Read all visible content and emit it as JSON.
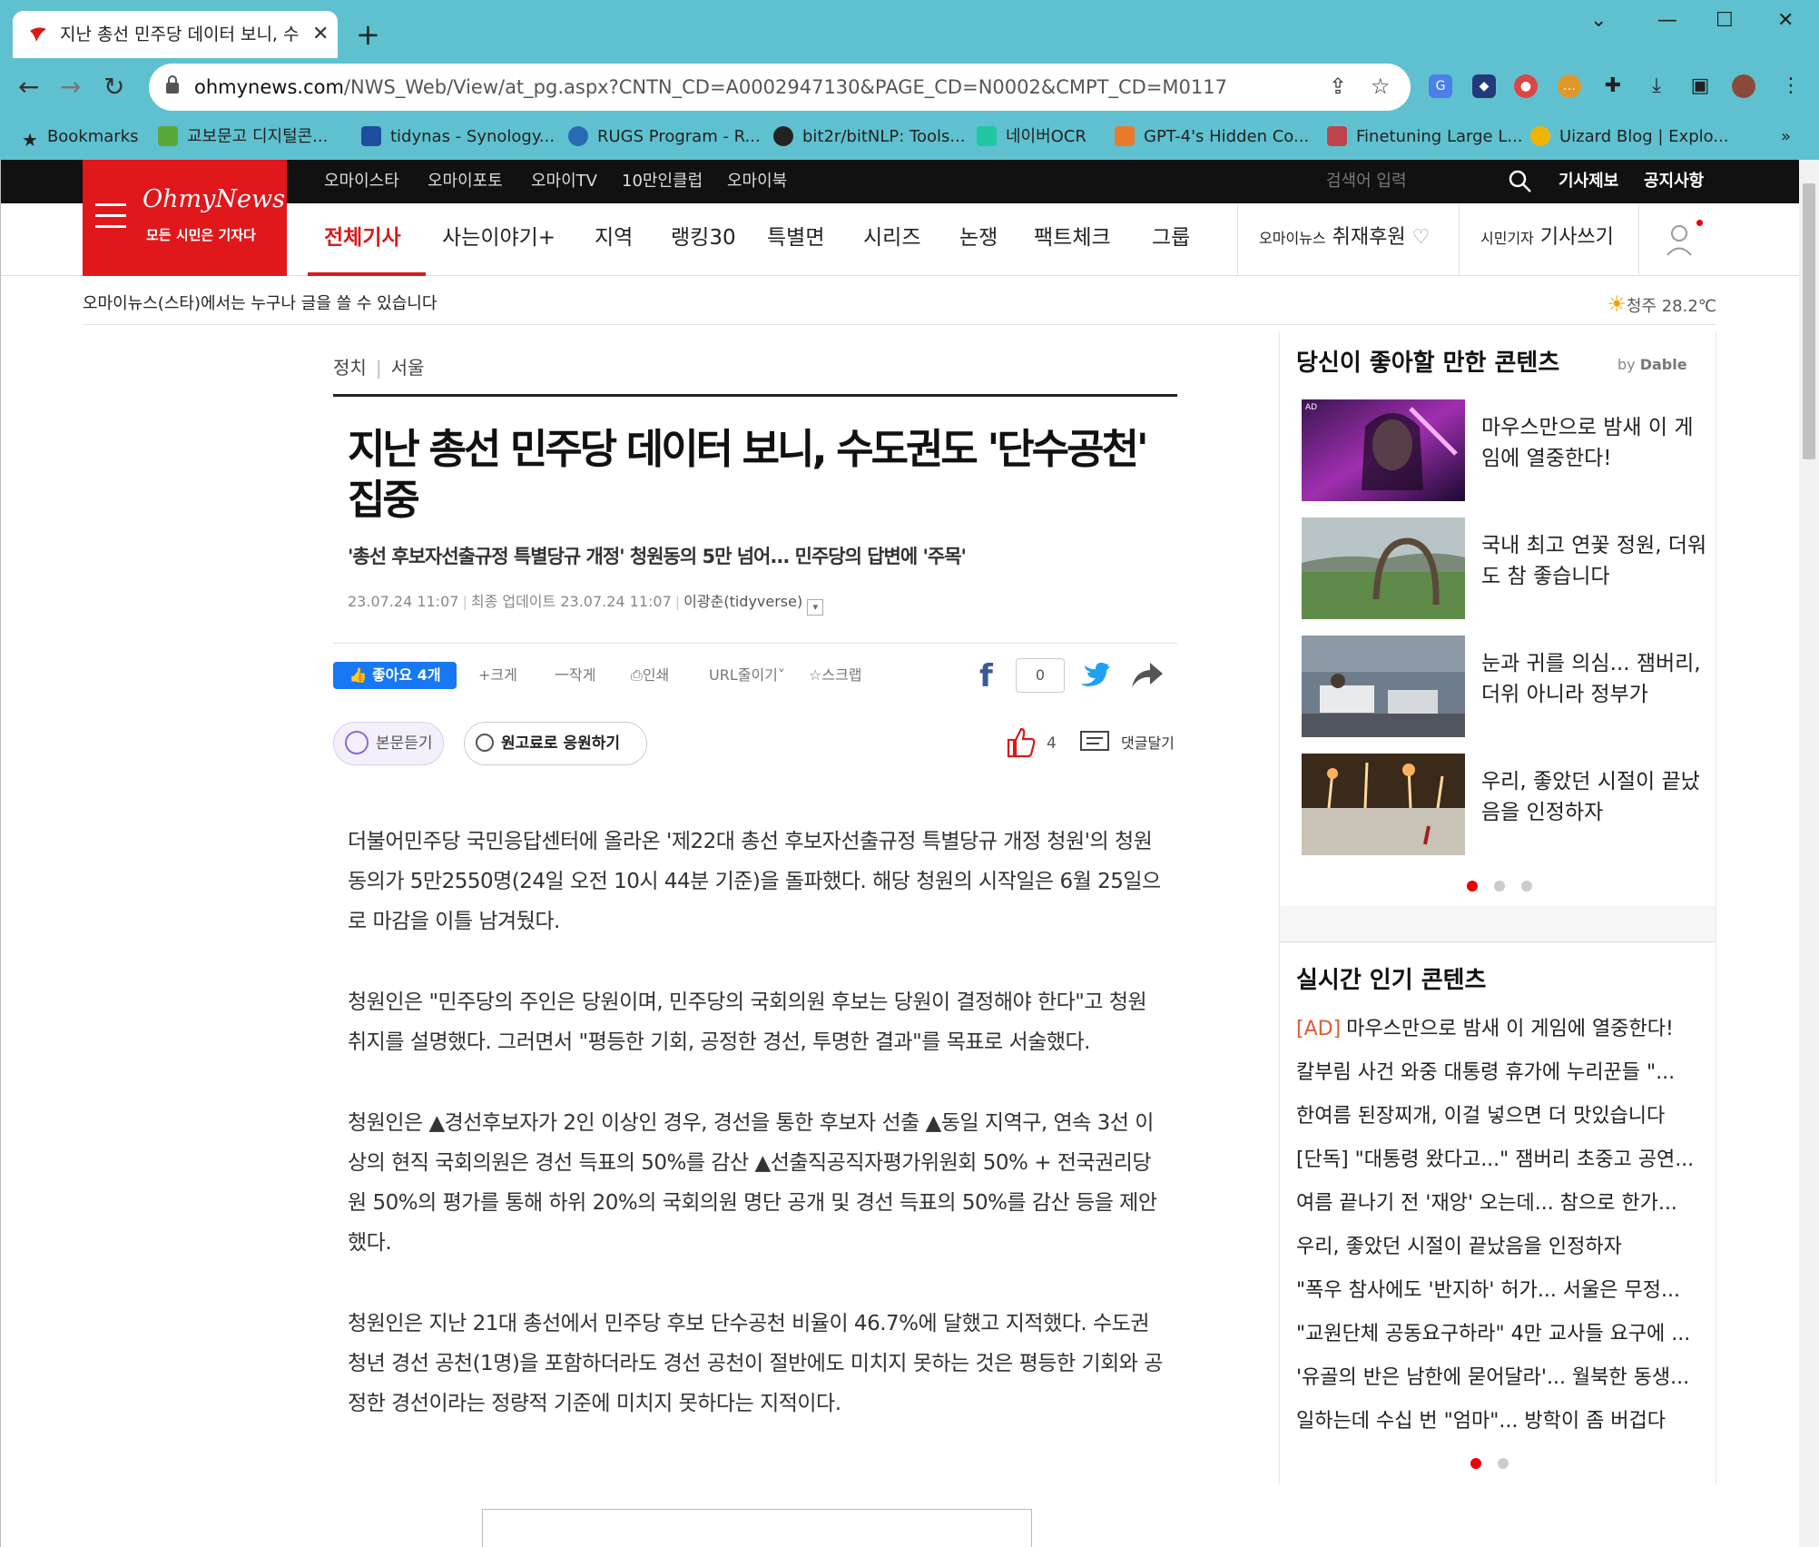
{
  "browser": {
    "tab_title": "지난 총선 민주당 데이터 보니, 수",
    "url_domain": "ohmynews.com",
    "url_path": "/NWS_Web/View/at_pg.aspx?CNTN_CD=A0002947130&PAGE_CD=N0002&CMPT_CD=M0117",
    "bookmarks": [
      {
        "label": "Bookmarks",
        "color": "#222222"
      },
      {
        "label": "교보문고 디지털콘...",
        "color": "#5aa83a"
      },
      {
        "label": "tidynas - Synology...",
        "color": "#1f4ea1"
      },
      {
        "label": "RUGS Program - R...",
        "color": "#2a6ab0"
      },
      {
        "label": "bit2r/bitNLP: Tools...",
        "color": "#222222"
      },
      {
        "label": "네이버OCR",
        "color": "#1fc8a0"
      },
      {
        "label": "GPT-4's Hidden Co...",
        "color": "#e87a2b"
      },
      {
        "label": "Finetuning Large L...",
        "color": "#c0444e"
      },
      {
        "label": "Uizard Blog | Explo...",
        "color": "#f0b400"
      }
    ],
    "more": "»"
  },
  "site": {
    "brand": "OhmyNews",
    "slogan": "모든 시민은 기자다",
    "top_links": [
      "오마이스타",
      "오마이포토",
      "오마이TV",
      "10만인클럽",
      "오마이북"
    ],
    "search_placeholder": "검색어 입력",
    "top_right": [
      "기사제보",
      "공지사항"
    ],
    "nav": [
      "전체기사",
      "사는이야기+",
      "지역",
      "랭킹30",
      "특별면",
      "시리즈",
      "논쟁",
      "팩트체크",
      "그룹"
    ],
    "sponsor_small": "오마이뉴스",
    "sponsor": "취재후원",
    "write_small": "시민기자",
    "write": "기사쓰기",
    "info_message": "오마이뉴스(스타)에서는 누구나 글을 쓸 수 있습니다",
    "weather": "청주 28.2℃"
  },
  "article": {
    "category": "정치",
    "region": "서울",
    "headline": "지난 총선 민주당 데이터 보니, 수도권도 '단수공천' 집중",
    "subhead": "'총선 후보자선출규정 특별당규 개정' 청원동의 5만 넘어... 민주당의 답변에 '주목'",
    "published": "23.07.24 11:07",
    "updated": "최종 업데이트 23.07.24 11:07",
    "author": "이광춘(tidyverse)",
    "like_label": "좋아요 4개",
    "tools": [
      "+크게",
      "一작게",
      "인쇄",
      "URL줄이기",
      "스크랩"
    ],
    "share_count": "0",
    "listen_label": "본문듣기",
    "support_label": "원고료로 응원하기",
    "recommend_count": "4",
    "comment_label": "댓글달기",
    "paragraphs": [
      "더불어민주당 국민응답센터에 올라온 '제22대 총선 후보자선출규정 특별당규 개정 청원'의 청원 동의가 5만2550명(24일 오전 10시 44분 기준)을 돌파했다. 해당 청원의 시작일은 6월 25일으로 마감을 이틀 남겨뒀다.",
      "청원인은 \"민주당의 주인은 당원이며, 민주당의 국회의원 후보는 당원이 결정해야 한다\"고 청원 취지를 설명했다. 그러면서 \"평등한 기회, 공정한 경선, 투명한 결과\"를 목표로 서술했다.",
      "청원인은 ▲경선후보자가 2인 이상인 경우, 경선을 통한 후보자 선출 ▲동일 지역구, 연속 3선 이상의 현직 국회의원은 경선 득표의 50%를 감산 ▲선출직공직자평가위원회 50% + 전국권리당원 50%의 평가를 통해 하위 20%의 국회의원 명단 공개 및 경선 득표의 50%를 감산 등을 제안했다.",
      "청원인은 지난 21대 총선에서 민주당 후보 단수공천 비율이 46.7%에 달했고 지적했다. 수도권 청년 경선 공천(1명)을 포함하더라도 경선 공천이 절반에도 미치지 못하는 것은 평등한 기회와 공정한 경선이라는 정량적 기준에 미치지 못하다는 지적이다."
    ]
  },
  "sidebar": {
    "recommend_title": "당신이 좋아할 만한 콘텐츠",
    "by": "by",
    "dable": "Dable",
    "ad_badge": "AD",
    "recommendations": [
      "마우스만으로 밤새 이 게임에 열중한다!",
      "국내 최고 연꽃 정원, 더워도 참 좋습니다",
      "눈과 귀를 의심... 잼버리, 더위 아니라 정부가",
      "우리, 좋았던 시절이 끝났음을 인정하자"
    ],
    "popular_title": "실시간 인기 콘텐츠",
    "popular_ad": "[AD]",
    "popular": [
      "마우스만으로 밤새 이 게임에 열중한다!",
      "칼부림 사건 와중 대통령 휴가에 누리꾼들 \"...",
      "한여름 된장찌개, 이걸 넣으면 더 맛있습니다",
      "[단독] \"대통령 왔다고...\" 잼버리 초중고 공연...",
      "여름 끝나기 전 '재앙' 오는데... 참으로 한가...",
      "우리, 좋았던 시절이 끝났음을 인정하자",
      "\"폭우 참사에도 '반지하' 허가... 서울은 무정...",
      "\"교원단체 공동요구하라\" 4만 교사들 요구에 ...",
      "'유골의 반은 남한에 묻어달라'... 월북한 동생...",
      "일하는데 수십 번 \"엄마\"... 방학이 좀 버겁다"
    ]
  },
  "colors": {
    "accent": "#d71b1b",
    "chrome": "#5fc1cf",
    "facebook": "#1877f2"
  }
}
